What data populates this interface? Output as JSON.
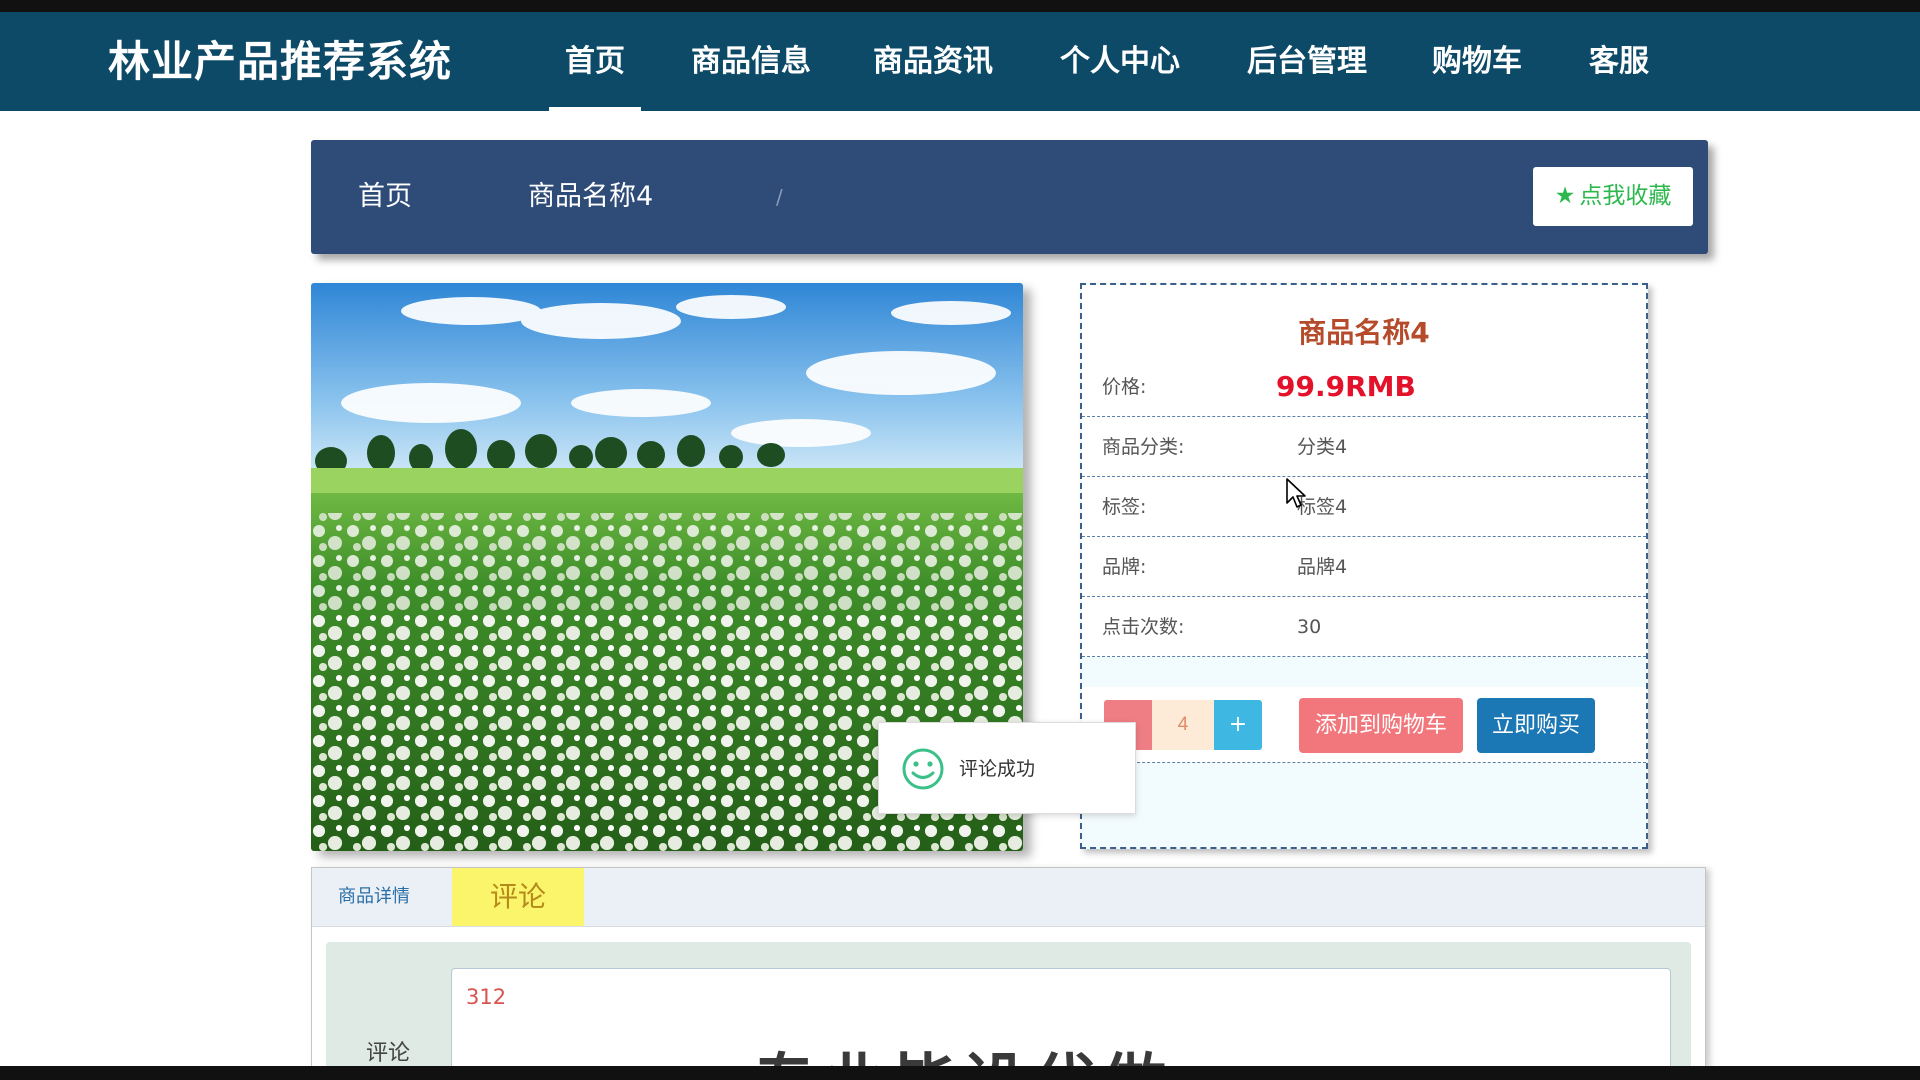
{
  "app": {
    "title": "林业产品推荐系统"
  },
  "nav": {
    "items": [
      {
        "label": "首页",
        "active": true
      },
      {
        "label": "商品信息"
      },
      {
        "label": "商品资讯"
      },
      {
        "label": "个人中心"
      },
      {
        "label": "后台管理"
      },
      {
        "label": "购物车"
      },
      {
        "label": "客服"
      }
    ]
  },
  "breadcrumb": {
    "home": "首页",
    "separator": "/",
    "current": "商品名称4",
    "favorite_label": "点我收藏"
  },
  "product": {
    "name": "商品名称4",
    "price_label": "价格:",
    "price_value": "99.9RMB",
    "category_label": "商品分类:",
    "category_value": "分类4",
    "tag_label": "标签:",
    "tag_value": "标签4",
    "brand_label": "品牌:",
    "brand_value": "品牌4",
    "clicks_label": "点击次数:",
    "clicks_value": "30",
    "quantity": "4",
    "plus_label": "+",
    "add_to_cart_label": "添加到购物车",
    "buy_now_label": "立即购买"
  },
  "toast": {
    "message": "评论成功"
  },
  "tabs": {
    "detail_label": "商品详情",
    "comment_label": "评论"
  },
  "comment": {
    "label": "评论",
    "typed_text": "312",
    "large_text": "专业毕设代做"
  },
  "colors": {
    "navbar": "#0d4a68",
    "breadcrumb_bar": "#2f4b77",
    "price": "#e4112a",
    "product_title": "#b54b2a",
    "favorite_green": "#2db84d",
    "cart_button": "#f2777c",
    "buy_button": "#1c78b5",
    "active_tab": "#faf56a"
  }
}
